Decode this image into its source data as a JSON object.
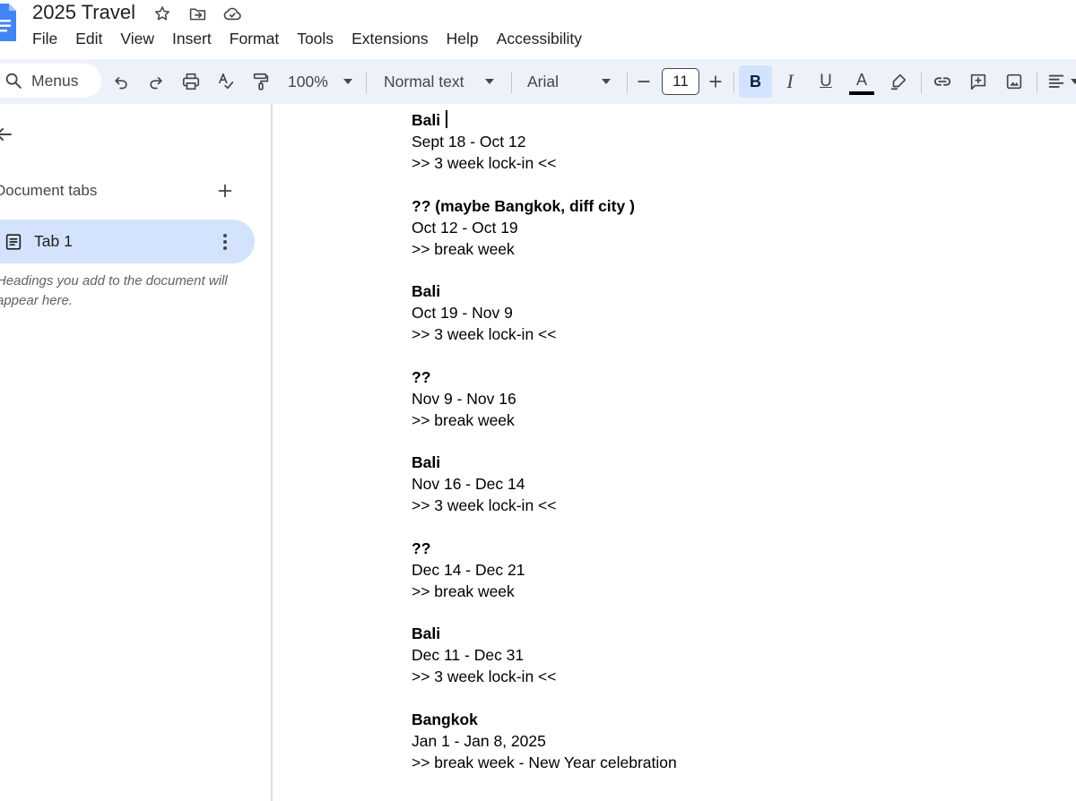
{
  "app": {
    "doc_title": "2025 Travel",
    "accent_color": "#0b57d0",
    "toolbar_bg": "#edf2fa"
  },
  "title_icons": [
    "star-icon",
    "move-to-folder-icon",
    "cloud-saved-icon"
  ],
  "menubar": {
    "items": [
      "File",
      "Edit",
      "View",
      "Insert",
      "Format",
      "Tools",
      "Extensions",
      "Help",
      "Accessibility"
    ]
  },
  "toolbar": {
    "search_label": "Menus",
    "zoom": "100%",
    "style": "Normal text",
    "font": "Arial",
    "font_size": "11",
    "bold_active": true,
    "bold_label": "B",
    "italic_label": "I",
    "underline_label": "U",
    "text_color_label": "A",
    "text_color": "#000000"
  },
  "sidebar": {
    "heading": "Document tabs",
    "tabs": [
      {
        "label": "Tab 1",
        "selected": true
      }
    ],
    "outline_hint": "Headings you add to the document will appear here."
  },
  "document": {
    "blocks": [
      {
        "heading": "Bali",
        "lines": [
          "Sept 18 - Oct 12",
          ">> 3 week lock-in <<"
        ]
      },
      {
        "heading": "?? (maybe Bangkok, diff city )",
        "lines": [
          "Oct 12 - Oct 19",
          ">> break week"
        ]
      },
      {
        "heading": "Bali",
        "lines": [
          "Oct 19 - Nov 9",
          ">> 3 week lock-in <<"
        ]
      },
      {
        "heading": "??",
        "lines": [
          "Nov 9 - Nov 16",
          ">> break week"
        ]
      },
      {
        "heading": "Bali",
        "lines": [
          "Nov 16 - Dec 14",
          ">> 3 week lock-in <<"
        ]
      },
      {
        "heading": "??",
        "lines": [
          "Dec 14 - Dec 21",
          ">> break week"
        ]
      },
      {
        "heading": "Bali",
        "lines": [
          "Dec 11 - Dec 31",
          ">> 3 week lock-in <<"
        ]
      },
      {
        "heading": "Bangkok",
        "lines": [
          "Jan 1 - Jan 8, 2025",
          ">> break week - New Year celebration"
        ]
      }
    ]
  }
}
